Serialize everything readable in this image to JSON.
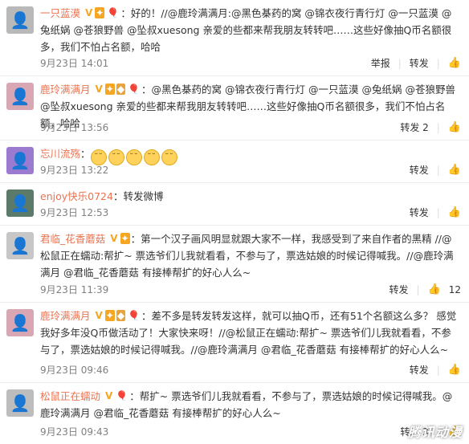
{
  "comments": [
    {
      "avatar_icon": "avatar-icon",
      "avatar_color": "#b9b9b9",
      "name": "一只蓝漠",
      "text": "：好的！//@鹿玲满满月:@黑色棊药的窝 @锦衣夜行青行灯 @一只蓝漠 @兔纸娲 @苍狼野兽 @坠叔xuesong 亲爱的些都来帮我朋友转转吧……这些好像抽Q币名额很多，我们不怕占名额，哈哈",
      "time": "9月23日 14:01",
      "report": "举报",
      "repost": "转发",
      "repost_count": "",
      "like_count": ""
    },
    {
      "avatar_icon": "avatar-icon",
      "avatar_color": "#d9a6b3",
      "name": "鹿玲满满月",
      "text": "：@黑色棊药的窝 @锦衣夜行青行灯 @一只蓝漠 @兔纸娲 @苍狼野兽 @坠叔xuesong 亲爱的些都来帮我朋友转转吧……这些好像抽Q币名额很多，我们不怕占名额，哈哈",
      "time": "9月23日 13:56",
      "repost": "转发 2",
      "like_count": ""
    },
    {
      "avatar_icon": "avatar-icon",
      "avatar_color": "#9b7bd0",
      "name": "忘川流殇",
      "text": "：",
      "emojis": [
        "😑",
        "😑",
        "😑",
        "😑",
        "😑"
      ],
      "time": "9月23日 13:22",
      "repost": "转发",
      "like_count": ""
    },
    {
      "avatar_icon": "avatar-icon",
      "avatar_color": "#5b7a6a",
      "name": "enjoy快乐0724",
      "text": "：转发微博",
      "time": "9月23日 12:53",
      "repost": "转发",
      "like_count": ""
    },
    {
      "avatar_icon": "avatar-icon",
      "avatar_color": "#c7c7c7",
      "name": "君临_花香蘑菇",
      "text": "：第一个汉子画风明显就跟大家不一样，我感受到了来自作者的黑精 //@松鼠正在蠕动:帮扩~ 票选爷们儿我就看看，不参与了，票选姑娘的时候记得喊我。//@鹿玲满满月 @君临_花香蘑菇 有接棒帮扩的好心人么~",
      "time": "9月23日 11:39",
      "repost": "转发",
      "like_count": "12"
    },
    {
      "avatar_icon": "avatar-icon",
      "avatar_color": "#d9a6b3",
      "name": "鹿玲满满月",
      "text": "：差不多是转发转发这样，就可以抽Q币，还有51个名额这么多？ 感觉我好多年没Q币做活动了！大家快来呀！//@松鼠正在蠕动:帮扩~ 票选爷们儿我就看看，不参与了，票选姑娘的时候记得喊我。//@鹿玲满满月 @君临_花香蘑菇 有接棒帮扩的好心人么~",
      "time": "9月23日 09:46",
      "repost": "转发",
      "like_count": ""
    },
    {
      "avatar_icon": "avatar-icon",
      "avatar_color": "#bdbdbd",
      "name": "松鼠正在蠕动",
      "text": "：帮扩~ 票选爷们儿我就看看，不参与了，票选姑娘的时候记得喊我。@鹿玲满满月 @君临_花香蘑菇 有接棒帮扩的好心人么~",
      "time": "9月23日 09:43",
      "repost": "转发 3",
      "like_count": ""
    }
  ],
  "watermark": "腾讯动漫"
}
